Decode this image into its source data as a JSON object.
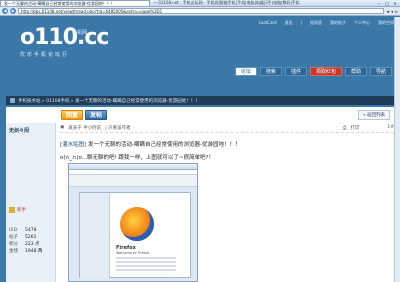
{
  "browser": {
    "active_tab": "发一个无聊的活动-瞒瞒自己经常使用的浏览器-优游园地！！！",
    "other_tabs": "— 01108.net · 手机论坛网 · 手机网|智能手机|手机|电脑|电器|3手|电脑|数码|手机",
    "url": "http://bbs.01108.net/viewthread.php?tid=6485005&extra=page%3D1",
    "tools": "★ ▾ ◎"
  },
  "site": {
    "logo_word": "o110.cc",
    "logo_sub": "手机网",
    "slogan": "优乐手机论坛行",
    "top_links": [
      "LastCard",
      "退出",
      "|",
      "短消息",
      "我的帖子",
      "个人中心",
      "我的空间"
    ],
    "nav": [
      "论坛",
      "搜索",
      "插件",
      "领取红包",
      "帮助",
      "导航"
    ]
  },
  "breadcrumb": "手机技术站 » 01108手机 » 发一个无聊的活动-瞒瞒自己经常使用的浏览器-优游园地！！！",
  "actions": {
    "reply": "回复",
    "post": "发帖",
    "back": "« 返回列表"
  },
  "user": {
    "name": "无剑々闲",
    "rank": "新手",
    "stats": [
      {
        "k": "UID",
        "v": "5478"
      },
      {
        "k": "帖子",
        "v": "5261"
      },
      {
        "k": "积分",
        "v": "223 点"
      },
      {
        "k": "金钱",
        "v": "1948 两"
      }
    ]
  },
  "post": {
    "meta_left": "发表于 半小时前",
    "meta_mid": "| 只看该作者",
    "meta_right": "打印",
    "meta_floor": "1#",
    "title_bracket": "[灌水贴图]",
    "title": "发一个无聊的活动-瞒瞒自己经常使用的浏览器-优游园地！！！",
    "body": "o(∩_∩)o...聊无聊的吧! 跟我一样，上图就可以了~很简单吧?！",
    "embed_brand": "Firefox",
    "embed_sub": "Welcome to Firefox"
  }
}
